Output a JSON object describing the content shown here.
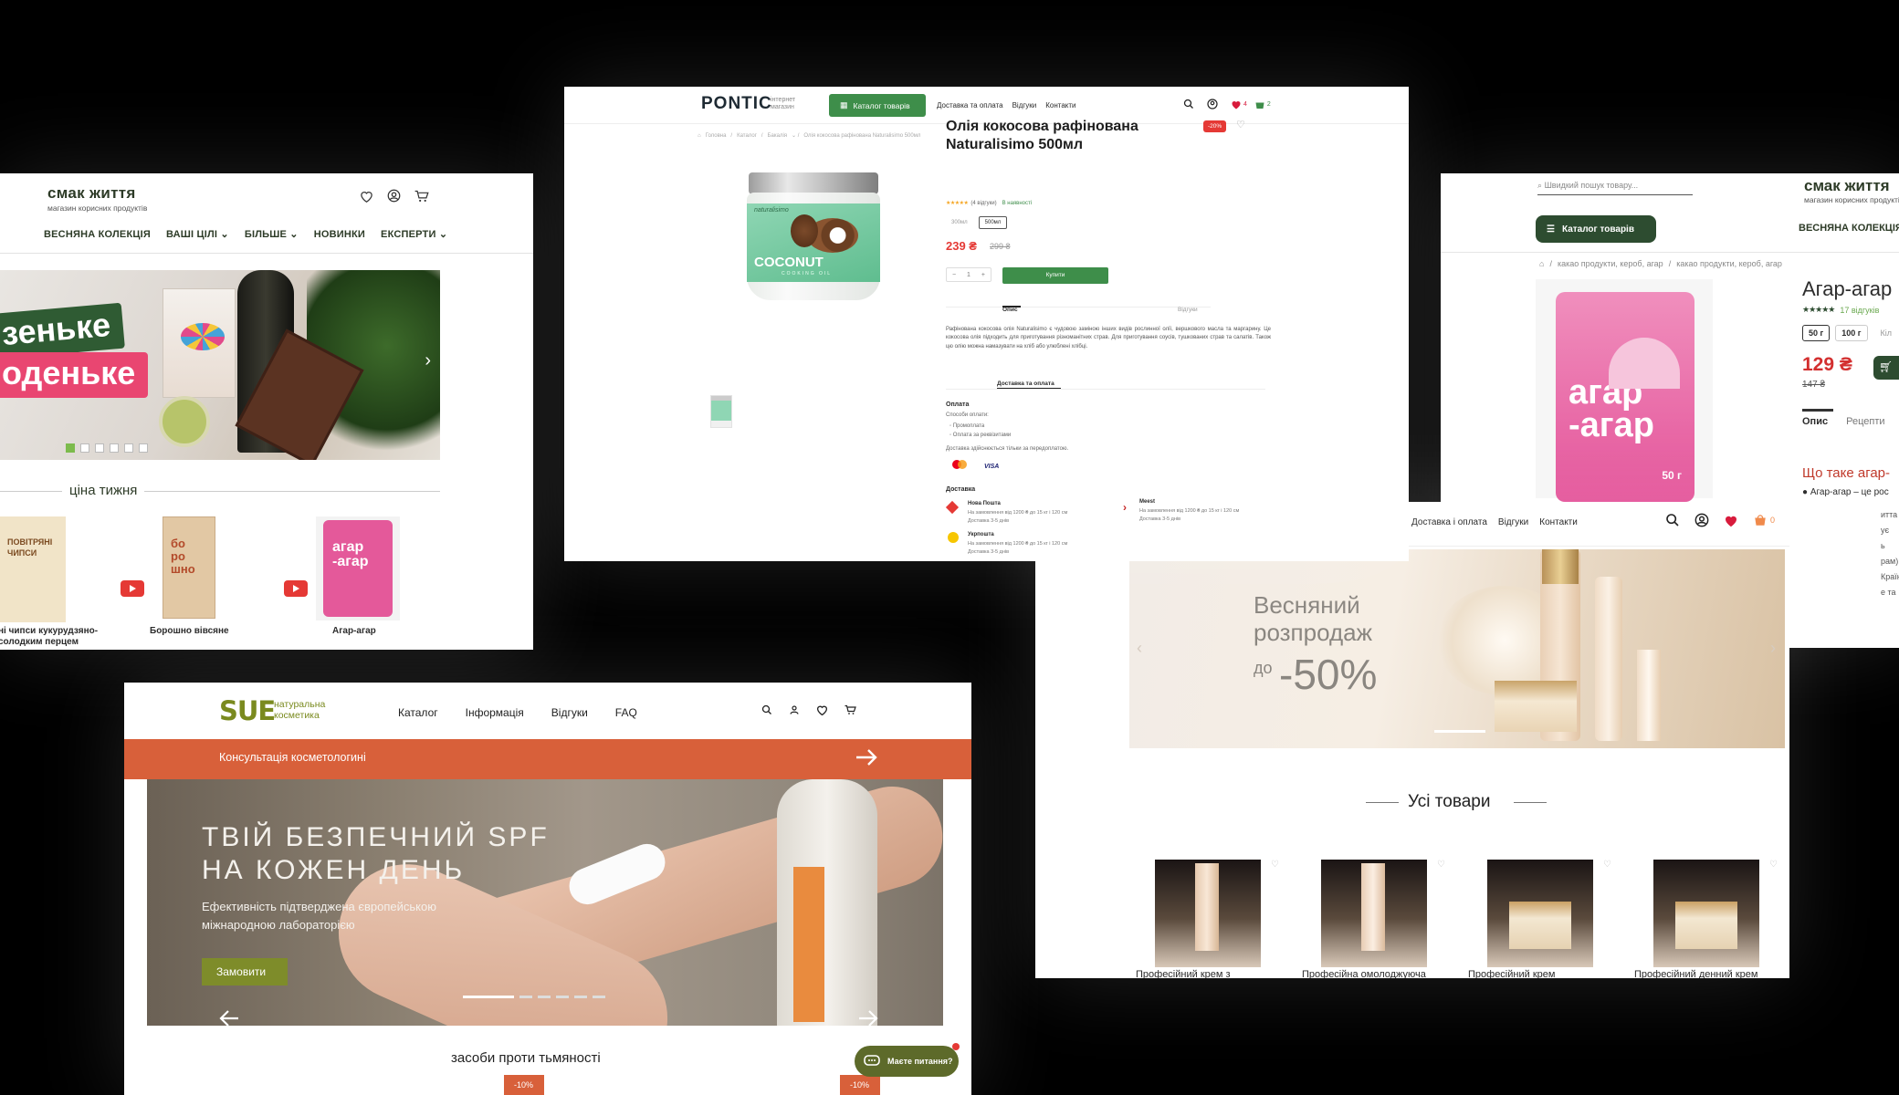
{
  "smak": {
    "logo": "смак життя",
    "tagline": "магазин корисних продуктів",
    "nav": [
      "ВЕСНЯНА КОЛЕКЦІЯ",
      "ВАШІ ЦІЛІ",
      "БІЛЬШЕ",
      "НОВИНКИ",
      "ЕКСПЕРТИ"
    ],
    "banner_line1": "зеньке",
    "banner_line2": "оденьке",
    "section_title": "ціна тижня",
    "products": [
      {
        "name": "ні чипси кукурудзяно-\nсолодким перцем",
        "pack_text": "ПОВІТРЯНІ\nЧИПСИ"
      },
      {
        "name": "Борошно вівсяне",
        "pack_text": "бо\nро\nшно"
      },
      {
        "name": "Агар-агар",
        "pack_text": "агар\n-агар"
      }
    ]
  },
  "pontic": {
    "logo": "PONTIC",
    "logo_sub": "інтернет\nмагазин",
    "catalog_button": "Каталог товарів",
    "nav": [
      "Доставка та оплата",
      "Відгуки",
      "Контакти"
    ],
    "wishlist_count": "4",
    "cart_count": "2",
    "breadcrumb": [
      "Головна",
      "Каталог",
      "Бакалія",
      "Олія кокосова рафінована Naturalisimo 500мл"
    ],
    "jar_brand": "naturalisimo",
    "jar_label": "COCONUT",
    "jar_sub": "COOKING OIL",
    "title": "Олія кокосова рафінована Naturalisimo 500мл",
    "discount": "-20%",
    "reviews": "(4 відгуки)",
    "stock": "В наявності",
    "volumes": [
      "300мл",
      "500мл"
    ],
    "price": "239 ₴",
    "old_price": "299 ₴",
    "qty": "1",
    "buy_button": "Купити",
    "tabs": [
      "Опис",
      "Відгуки"
    ],
    "description": "Рафінована кокосова олія Naturalisimo є чудовою заміною інших видів рослинної олії, вершкового масла та маргарину. Це кокосова олія підходить для приготування різноманітних страв. Для приготування соусів, тушкованих страв та салатів. Також цю олію можна намазувати на хліб або улюблені хлібці.",
    "delivery_tab": "Доставка та оплата",
    "payment_title": "Оплата",
    "payment_methods_title": "Способи оплати:",
    "payment_methods": [
      "Промоплата",
      "Оплата за реквізитами"
    ],
    "payment_note": "Доставка здійснюється тільки за передоплатою.",
    "cards": [
      "",
      "VISA"
    ],
    "delivery_title": "Доставка",
    "carriers": [
      {
        "name": "Нова Пошта",
        "line1": "На замовлення від 1200 ₴ до 15 кг і 120 см",
        "line2": "Доставка 3-5 днів"
      },
      {
        "name": "Meest",
        "line1": "На замовлення від 1200 ₴ до 15 кг і 120 см",
        "line2": "Доставка 3-5 днів"
      },
      {
        "name": "Укрпошта",
        "line1": "На замовлення від 1200 ₴ до 15 кг і 120 см",
        "line2": "Доставка 3-5 днів"
      }
    ]
  },
  "sue": {
    "logo": "SUE",
    "tagline": "натуральна\nкосметика",
    "nav": [
      "Каталог",
      "Інформація",
      "Відгуки",
      "FAQ"
    ],
    "consult_bar": "Консультація косметологині",
    "hero_title": "ТВІЙ БЕЗПЕЧНИЙ SPF\nНА КОЖЕН ДЕНЬ",
    "hero_sub": "Ефективність підтверджена європейською\nміжнародною лабораторією",
    "order_button": "Замовити",
    "section_title": "засоби проти тьмяності",
    "chat_label": "Маєте питання?",
    "badges": [
      "-10%",
      "-10%"
    ]
  },
  "agar": {
    "search_placeholder": "Швидкий пошук товару...",
    "logo": "смак життя",
    "tagline": "магазин корисних продуктів",
    "catalog_button": "Каталог товарів",
    "nav_item": "ВЕСНЯНА КОЛЕКЦІЯ",
    "breadcrumb": [
      "какао продукти, кероб, агар",
      "какао продукти, кероб, агар"
    ],
    "pack_text": "агар\n-агар",
    "pack_weight": "50 г",
    "title": "Агар-агар",
    "reviews": "17 відгуків",
    "weights": [
      "50 г",
      "100 г"
    ],
    "qty_label": "Кіл",
    "price": "129 ₴",
    "old_price": "147 ₴",
    "tabs": [
      "Опис",
      "Рецепти"
    ],
    "question": "Що таке агар-",
    "bullet": "Агар-агар – це рос",
    "side_words": [
      "итта",
      "ує",
      "ь",
      "рам)",
      "Країн",
      "е та"
    ]
  },
  "nava": {
    "nav": [
      "Доставка і оплата",
      "Відгуки",
      "Контакти"
    ],
    "cart_count": "0",
    "banner_title": "Весняний\nрозпродаж",
    "banner_do": "до",
    "banner_pct": "-50%",
    "section_title": "Усі товари",
    "products": [
      "Професійний крем з",
      "Професійна омолоджуюча",
      "Професійний крем",
      "Професійний денний крем"
    ]
  }
}
